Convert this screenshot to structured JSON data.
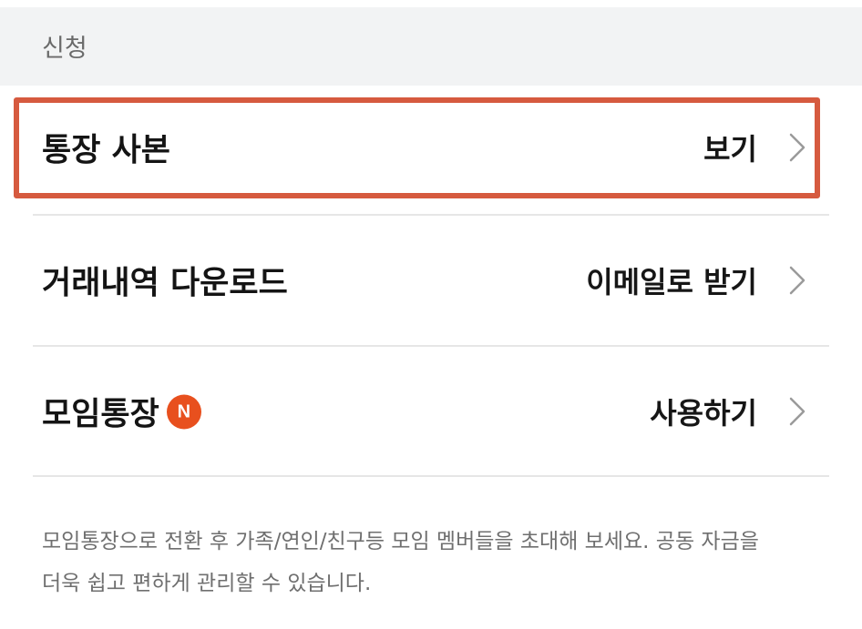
{
  "section": {
    "title": "신청"
  },
  "rows": [
    {
      "label": "통장 사본",
      "action": "보기",
      "highlighted": true
    },
    {
      "label": "거래내역 다운로드",
      "action": "이메일로 받기"
    },
    {
      "label": "모임통장",
      "badge": "N",
      "action": "사용하기"
    }
  ],
  "note": {
    "line1": "모임통장으로 전환 후 가족/연인/친구등 모임 멤버들을 초대해 보세요. 공동 자금을",
    "line2": "더욱 쉽고 편하게 관리할 수 있습니다."
  },
  "colors": {
    "highlight_border": "#d65a3f",
    "badge": "#e8501e",
    "header_bg": "#f2f3f4"
  },
  "icons": {
    "chevron": "chevron-right-icon"
  }
}
